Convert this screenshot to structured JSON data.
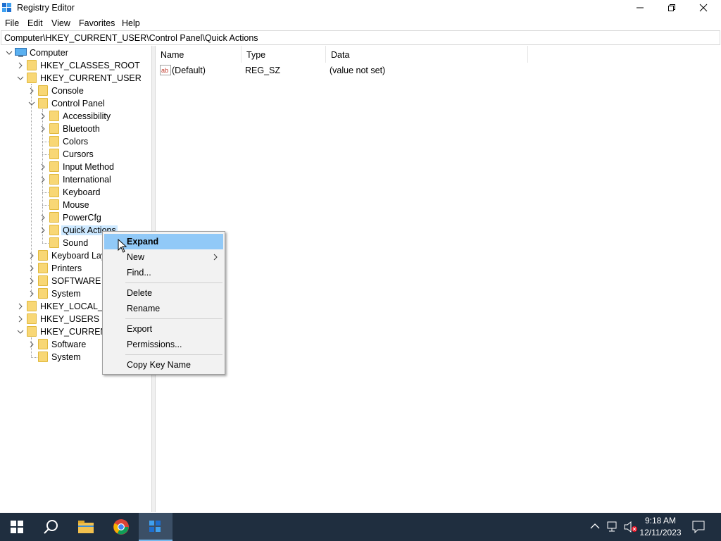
{
  "window": {
    "title": "Registry Editor",
    "menus": [
      "File",
      "Edit",
      "View",
      "Favorites",
      "Help"
    ],
    "address": "Computer\\HKEY_CURRENT_USER\\Control Panel\\Quick Actions"
  },
  "tree": {
    "root": "Computer",
    "nodes": [
      {
        "label": "HKEY_CLASSES_ROOT",
        "level": 1,
        "expander": "collapsed"
      },
      {
        "label": "HKEY_CURRENT_USER",
        "level": 1,
        "expander": "expanded"
      },
      {
        "label": "Console",
        "level": 2,
        "expander": "collapsed"
      },
      {
        "label": "Control Panel",
        "level": 2,
        "expander": "expanded"
      },
      {
        "label": "Accessibility",
        "level": 3,
        "expander": "collapsed"
      },
      {
        "label": "Bluetooth",
        "level": 3,
        "expander": "collapsed"
      },
      {
        "label": "Colors",
        "level": 3,
        "expander": "none"
      },
      {
        "label": "Cursors",
        "level": 3,
        "expander": "none"
      },
      {
        "label": "Input Method",
        "level": 3,
        "expander": "collapsed"
      },
      {
        "label": "International",
        "level": 3,
        "expander": "collapsed"
      },
      {
        "label": "Keyboard",
        "level": 3,
        "expander": "none"
      },
      {
        "label": "Mouse",
        "level": 3,
        "expander": "none"
      },
      {
        "label": "PowerCfg",
        "level": 3,
        "expander": "collapsed"
      },
      {
        "label": "Quick Actions",
        "level": 3,
        "expander": "collapsed",
        "selected": true
      },
      {
        "label": "Sound",
        "level": 3,
        "expander": "none"
      },
      {
        "label": "Keyboard Lay",
        "level": 2,
        "expander": "collapsed"
      },
      {
        "label": "Printers",
        "level": 2,
        "expander": "collapsed"
      },
      {
        "label": "SOFTWARE",
        "level": 2,
        "expander": "collapsed"
      },
      {
        "label": "System",
        "level": 2,
        "expander": "collapsed"
      },
      {
        "label": "HKEY_LOCAL_M",
        "level": 1,
        "expander": "collapsed"
      },
      {
        "label": "HKEY_USERS",
        "level": 1,
        "expander": "collapsed"
      },
      {
        "label": "HKEY_CURRENT_",
        "level": 1,
        "expander": "expanded"
      },
      {
        "label": "Software",
        "level": 2,
        "expander": "collapsed"
      },
      {
        "label": "System",
        "level": 2,
        "expander": "none"
      }
    ]
  },
  "list": {
    "columns": [
      "Name",
      "Type",
      "Data"
    ],
    "rows": [
      {
        "name": "(Default)",
        "type": "REG_SZ",
        "data": "(value not set)"
      }
    ]
  },
  "context_menu": {
    "items": [
      {
        "label": "Expand",
        "bold": true,
        "highlight": true
      },
      {
        "label": "New",
        "submenu": true
      },
      {
        "label": "Find..."
      },
      {
        "separator": true
      },
      {
        "label": "Delete"
      },
      {
        "label": "Rename"
      },
      {
        "separator": true
      },
      {
        "label": "Export"
      },
      {
        "label": "Permissions..."
      },
      {
        "separator": true
      },
      {
        "label": "Copy Key Name"
      }
    ]
  },
  "taskbar": {
    "time": "9:18 AM",
    "date": "12/11/2023"
  },
  "colors": {
    "selection": "#cce8ff",
    "menu_highlight": "#91c9f7",
    "taskbar": "#1f2e3f",
    "folder": "#f8d775"
  }
}
